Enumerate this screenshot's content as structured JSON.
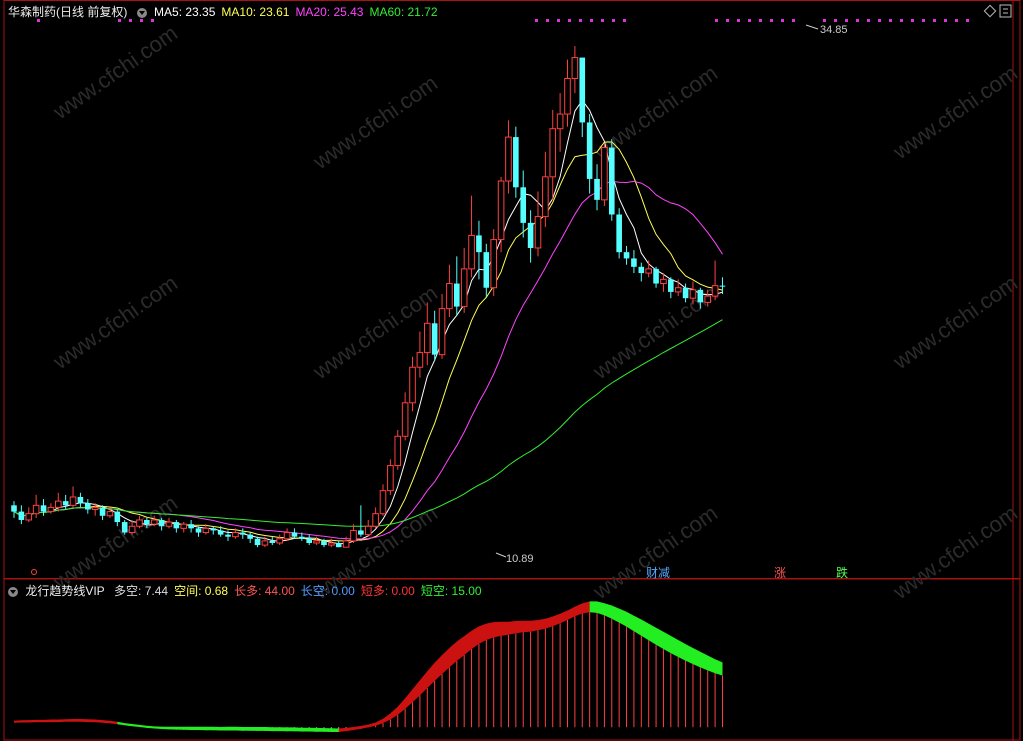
{
  "main_panel": {
    "title": "华森制药(日线 前复权)",
    "ma": [
      {
        "label": "MA5: 23.35",
        "color": "#ffffff"
      },
      {
        "label": "MA10: 23.61",
        "color": "#ffff55"
      },
      {
        "label": "MA20: 25.43",
        "color": "#ff44ff"
      },
      {
        "label": "MA60: 21.72",
        "color": "#33ee33"
      }
    ],
    "high_label": "34.85",
    "low_label": "10.89",
    "signals": [
      {
        "text": "财减",
        "color": "#55aaff"
      },
      {
        "text": "涨",
        "color": "#ff5555"
      },
      {
        "text": "跌",
        "color": "#55ff55"
      }
    ]
  },
  "sub_panel": {
    "title": "龙行趋势线VIP",
    "values": [
      {
        "label": "多空: 7.44",
        "color": "#dddddd"
      },
      {
        "label": "空间: 0.68",
        "color": "#ffff55"
      },
      {
        "label": "长多: 44.00",
        "color": "#ff5555"
      },
      {
        "label": "长空: 0.00",
        "color": "#5599ff"
      },
      {
        "label": "短多: 0.00",
        "color": "#ff3333"
      },
      {
        "label": "短空: 15.00",
        "color": "#33ee33"
      }
    ]
  },
  "watermark": "www.cfchi.com",
  "chart_data": {
    "type": "candlestick",
    "price_range": [
      10.0,
      36.0
    ],
    "up_color": "#ff4040",
    "down_color": "#55ffff",
    "candles": [
      [
        12.9,
        12.6,
        13.1,
        12.3
      ],
      [
        12.6,
        12.2,
        12.9,
        12.0
      ],
      [
        12.2,
        12.5,
        12.8,
        12.1
      ],
      [
        12.5,
        12.9,
        13.4,
        12.3
      ],
      [
        12.9,
        12.6,
        13.2,
        12.4
      ],
      [
        12.6,
        12.8,
        13.0,
        12.5
      ],
      [
        12.8,
        13.1,
        13.5,
        12.6
      ],
      [
        13.1,
        12.9,
        13.4,
        12.7
      ],
      [
        12.9,
        13.3,
        13.8,
        12.8
      ],
      [
        13.3,
        13.0,
        13.5,
        12.8
      ],
      [
        13.0,
        12.7,
        13.2,
        12.5
      ],
      [
        12.7,
        12.8,
        13.0,
        12.4
      ],
      [
        12.8,
        12.4,
        12.9,
        12.2
      ],
      [
        12.4,
        12.6,
        12.8,
        12.3
      ],
      [
        12.6,
        12.1,
        12.7,
        11.9
      ],
      [
        12.1,
        11.6,
        12.2,
        11.5
      ],
      [
        11.6,
        11.9,
        12.2,
        11.5
      ],
      [
        11.9,
        12.2,
        12.4,
        11.8
      ],
      [
        12.2,
        12.0,
        12.3,
        11.8
      ],
      [
        12.0,
        12.2,
        12.4,
        11.9
      ],
      [
        12.2,
        11.9,
        12.3,
        11.7
      ],
      [
        11.9,
        12.1,
        12.3,
        11.8
      ],
      [
        12.1,
        11.8,
        12.2,
        11.6
      ],
      [
        11.8,
        12.0,
        12.1,
        11.6
      ],
      [
        12.0,
        11.8,
        12.2,
        11.6
      ],
      [
        11.8,
        11.6,
        11.9,
        11.4
      ],
      [
        11.6,
        11.8,
        12.0,
        11.5
      ],
      [
        11.8,
        11.7,
        11.9,
        11.5
      ],
      [
        11.7,
        11.5,
        11.9,
        11.4
      ],
      [
        11.5,
        11.4,
        11.7,
        11.2
      ],
      [
        11.4,
        11.6,
        11.8,
        11.3
      ],
      [
        11.6,
        11.5,
        11.8,
        11.3
      ],
      [
        11.5,
        11.3,
        11.6,
        11.1
      ],
      [
        11.3,
        11.0,
        11.4,
        10.9
      ],
      [
        11.0,
        11.2,
        11.4,
        10.9
      ],
      [
        11.2,
        11.1,
        11.4,
        11.0
      ],
      [
        11.1,
        11.3,
        11.5,
        11.0
      ],
      [
        11.3,
        11.6,
        11.8,
        11.2
      ],
      [
        11.6,
        11.4,
        11.8,
        11.3
      ],
      [
        11.4,
        11.3,
        11.6,
        11.2
      ],
      [
        11.3,
        11.1,
        11.5,
        11.0
      ],
      [
        11.1,
        11.2,
        11.4,
        11.0
      ],
      [
        11.2,
        11.0,
        11.3,
        10.9
      ],
      [
        11.0,
        11.1,
        11.3,
        10.9
      ],
      [
        11.1,
        10.9,
        11.2,
        10.89
      ],
      [
        10.9,
        11.2,
        11.4,
        10.89
      ],
      [
        11.2,
        11.7,
        12.0,
        11.1
      ],
      [
        11.7,
        11.5,
        12.9,
        11.4
      ],
      [
        11.5,
        11.9,
        12.2,
        11.4
      ],
      [
        11.9,
        12.5,
        12.8,
        11.8
      ],
      [
        12.5,
        13.6,
        13.9,
        12.4
      ],
      [
        13.6,
        14.8,
        15.1,
        13.4
      ],
      [
        14.8,
        16.2,
        16.5,
        14.6
      ],
      [
        16.2,
        17.8,
        18.3,
        16.0
      ],
      [
        17.8,
        19.5,
        20.0,
        17.4
      ],
      [
        19.5,
        20.2,
        21.2,
        19.0
      ],
      [
        20.2,
        21.6,
        22.6,
        19.6
      ],
      [
        21.6,
        20.1,
        22.2,
        19.8
      ],
      [
        20.1,
        22.3,
        23.0,
        19.9
      ],
      [
        22.3,
        23.5,
        24.4,
        21.9
      ],
      [
        23.5,
        22.4,
        24.8,
        22.0
      ],
      [
        22.4,
        24.2,
        25.2,
        22.1
      ],
      [
        24.2,
        25.8,
        27.7,
        23.8
      ],
      [
        25.8,
        25.0,
        26.5,
        23.7
      ],
      [
        25.0,
        23.3,
        25.4,
        22.8
      ],
      [
        23.3,
        25.6,
        26.1,
        22.9
      ],
      [
        25.6,
        28.4,
        28.6,
        25.0
      ],
      [
        28.4,
        30.5,
        31.3,
        27.8
      ],
      [
        30.5,
        28.1,
        31.0,
        27.6
      ],
      [
        28.1,
        26.4,
        28.9,
        25.7
      ],
      [
        26.4,
        25.2,
        27.0,
        24.5
      ],
      [
        25.2,
        26.7,
        27.9,
        24.8
      ],
      [
        26.7,
        28.6,
        29.8,
        26.2
      ],
      [
        28.6,
        30.9,
        31.8,
        27.5
      ],
      [
        30.9,
        31.6,
        32.6,
        29.8
      ],
      [
        31.6,
        33.3,
        34.2,
        31.0
      ],
      [
        33.3,
        34.3,
        34.85,
        32.6
      ],
      [
        34.3,
        31.2,
        34.0,
        30.5
      ],
      [
        31.2,
        28.5,
        31.6,
        27.8
      ],
      [
        28.5,
        27.5,
        29.2,
        27.0
      ],
      [
        27.5,
        30.0,
        30.2,
        27.2
      ],
      [
        30.0,
        26.8,
        30.4,
        26.5
      ],
      [
        26.8,
        25.0,
        27.1,
        24.7
      ],
      [
        25.0,
        24.7,
        25.3,
        24.4
      ],
      [
        24.7,
        24.3,
        25.1,
        24.0
      ],
      [
        24.3,
        24.0,
        24.5,
        23.6
      ],
      [
        24.0,
        24.2,
        24.6,
        23.8
      ],
      [
        24.2,
        23.5,
        24.3,
        23.3
      ],
      [
        23.5,
        23.7,
        24.0,
        23.1
      ],
      [
        23.7,
        23.1,
        23.8,
        22.8
      ],
      [
        23.1,
        23.3,
        23.7,
        22.9
      ],
      [
        23.3,
        22.8,
        23.5,
        22.6
      ],
      [
        22.8,
        23.2,
        23.6,
        22.5
      ],
      [
        23.2,
        22.6,
        23.3,
        22.3
      ],
      [
        22.6,
        22.9,
        23.2,
        22.4
      ],
      [
        22.9,
        23.4,
        24.6,
        22.7
      ],
      [
        23.4,
        23.35,
        23.8,
        23.0
      ]
    ],
    "trend_values": [
      2.1,
      2.2,
      2.2,
      2.3,
      2.3,
      2.4,
      2.4,
      2.5,
      2.5,
      2.5,
      2.4,
      2.3,
      2.1,
      1.8,
      1.4,
      0.9,
      0.5,
      0.1,
      -0.3,
      -0.6,
      -0.8,
      -1.0,
      -1.1,
      -1.2,
      -1.3,
      -1.3,
      -1.4,
      -1.4,
      -1.5,
      -1.5,
      -1.5,
      -1.6,
      -1.6,
      -1.7,
      -1.7,
      -1.8,
      -1.8,
      -1.9,
      -1.9,
      -2.0,
      -2.0,
      -2.1,
      -2.1,
      -2.2,
      -2.2,
      -1.8,
      -1.3,
      -0.7,
      -0.1,
      0.7,
      1.9,
      3.6,
      5.8,
      8.5,
      11.6,
      14.8,
      18.2,
      21.6,
      24.7,
      27.8,
      30.8,
      33.5,
      36.3,
      38.7,
      40.5,
      41.7,
      42.4,
      42.9,
      43.6,
      44.1,
      44.4,
      45.0,
      45.8,
      46.9,
      48.3,
      49.8,
      51.5,
      52.8,
      53.4,
      53.1,
      51.9,
      50.4,
      48.6,
      46.7,
      44.6,
      42.5,
      40.4,
      38.3,
      36.3,
      34.4,
      32.6,
      30.9,
      29.3,
      27.8,
      26.4,
      25.1,
      24.0
    ],
    "trend_width": [
      1.0,
      1.0,
      1.1,
      1.1,
      1.1,
      1.2,
      1.2,
      1.2,
      1.3,
      1.3,
      1.3,
      1.3,
      1.2,
      1.2,
      1.1,
      1.0,
      1.0,
      1.0,
      1.0,
      1.0,
      1.1,
      1.2,
      1.3,
      1.4,
      1.5,
      1.5,
      1.6,
      1.6,
      1.6,
      1.7,
      1.7,
      1.7,
      1.7,
      1.8,
      1.8,
      1.8,
      1.8,
      1.8,
      1.8,
      1.8,
      1.8,
      1.8,
      1.7,
      1.7,
      1.6,
      1.5,
      1.4,
      1.3,
      1.3,
      1.5,
      2.0,
      2.8,
      3.8,
      4.9,
      6.0,
      7.0,
      7.8,
      8.4,
      8.8,
      9.0,
      9.0,
      8.8,
      8.5,
      8.1,
      7.6,
      7.1,
      6.6,
      6.1,
      5.7,
      5.3,
      5.0,
      4.8,
      4.6,
      4.5,
      4.4,
      4.4,
      4.5,
      4.7,
      5.0,
      5.3,
      5.7,
      6.1,
      6.5,
      6.9,
      7.2,
      7.5,
      7.7,
      7.9,
      8.0,
      8.0,
      7.9,
      7.7,
      7.5,
      7.2,
      6.9,
      6.5,
      6.1
    ],
    "sub_range": [
      -5,
      60
    ]
  }
}
